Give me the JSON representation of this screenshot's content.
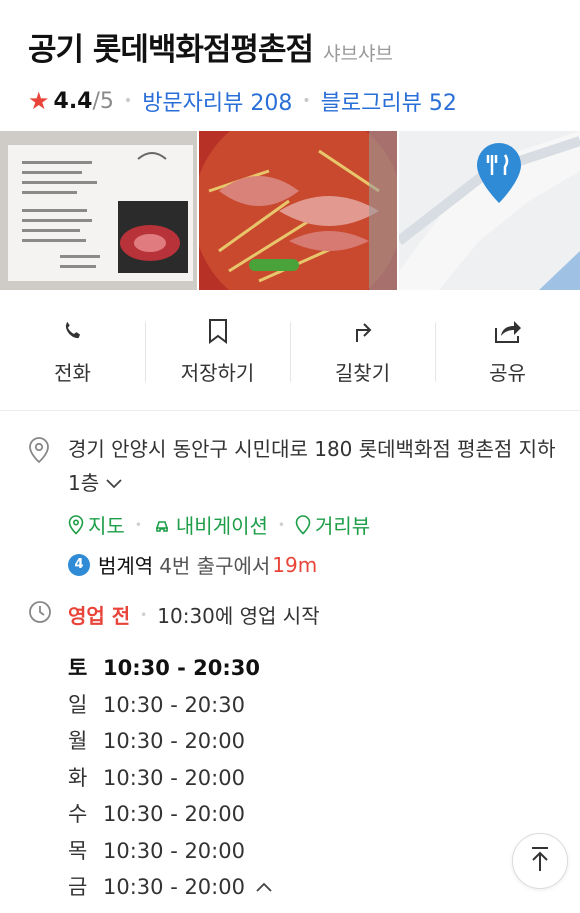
{
  "place": {
    "name": "공기 롯데백화점평촌점",
    "category": "샤브샤브",
    "rating": "4.4",
    "rating_max": "/5",
    "visitor_reviews": "방문자리뷰 208",
    "blog_reviews": "블로그리뷰 52"
  },
  "actions": [
    {
      "label": "전화",
      "icon": "phone-icon"
    },
    {
      "label": "저장하기",
      "icon": "bookmark-icon"
    },
    {
      "label": "길찾기",
      "icon": "directions-icon"
    },
    {
      "label": "공유",
      "icon": "share-icon"
    }
  ],
  "address": {
    "text": "경기 안양시 동안구 시민대로 180 롯데백화점 평촌점 지하 1층",
    "links": [
      "지도",
      "내비게이션",
      "거리뷰"
    ]
  },
  "subway": {
    "line": "4",
    "station": "범계역",
    "exit": "4번 출구에서",
    "distance": "19m"
  },
  "hours": {
    "status": "영업 전",
    "note": "10:30에 영업 시작",
    "schedule": [
      {
        "day": "토",
        "time": "10:30 - 20:30"
      },
      {
        "day": "일",
        "time": "10:30 - 20:30"
      },
      {
        "day": "월",
        "time": "10:30 - 20:00"
      },
      {
        "day": "화",
        "time": "10:30 - 20:00"
      },
      {
        "day": "수",
        "time": "10:30 - 20:00"
      },
      {
        "day": "목",
        "time": "10:30 - 20:00"
      },
      {
        "day": "금",
        "time": "10:30 - 20:00"
      }
    ]
  },
  "colors": {
    "accent_red": "#e8443a",
    "link_blue": "#2a6fd8",
    "link_green": "#1e9e48",
    "map_pin_blue": "#2f8bd6"
  }
}
